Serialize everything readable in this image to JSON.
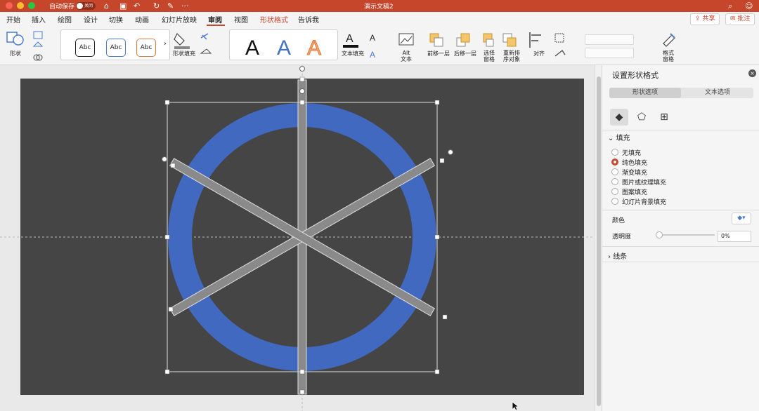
{
  "titlebar": {
    "autosave_label": "自动保存",
    "autosave_state": "关闭",
    "doc_title": "演示文稿2",
    "more_label": "···"
  },
  "menu": {
    "items": [
      "开始",
      "插入",
      "绘图",
      "设计",
      "切换",
      "动画",
      "幻灯片放映",
      "审阅",
      "视图",
      "形状格式",
      "告诉我"
    ],
    "active": "审阅",
    "contextual": "形状格式"
  },
  "header_buttons": {
    "share": "共享",
    "comment": "批注"
  },
  "ribbon": {
    "shape_label": "形状",
    "style_gallery": [
      "Abc",
      "Abc",
      "Abc"
    ],
    "shape_fill": "形状填充",
    "wordart": [
      "A",
      "A",
      "A"
    ],
    "text_fill": "文本填充",
    "alt_text": [
      "Alt",
      "文本"
    ],
    "bring_forward": "前移一层",
    "send_backward": "后移一层",
    "selection_pane": [
      "选择",
      "窗格"
    ],
    "reorder_objects": [
      "重新排",
      "序对象"
    ],
    "align": "对齐",
    "format_pane": [
      "格式",
      "窗格"
    ]
  },
  "panel": {
    "title": "设置形状格式",
    "tabs": [
      "形状选项",
      "文本选项"
    ],
    "fill_section": "填充",
    "fill_options": [
      "无填充",
      "纯色填充",
      "渐变填充",
      "图片或纹理填充",
      "图案填充",
      "幻灯片背景填充"
    ],
    "selected_fill": "纯色填充",
    "color_label": "颜色",
    "transparency_label": "透明度",
    "transparency_value": "0%",
    "line_section": "线条"
  },
  "colors": {
    "accent": "#c6462c",
    "ring": "#4169c0",
    "slide_bg": "#454545",
    "bar": "#8a8a8a"
  },
  "icons": {
    "close": "close-icon",
    "home": "home-icon",
    "undo": "undo-icon",
    "fill_tab": "paint-bucket-icon",
    "shape_tab": "pentagon-icon",
    "size_tab": "size-properties-icon"
  }
}
